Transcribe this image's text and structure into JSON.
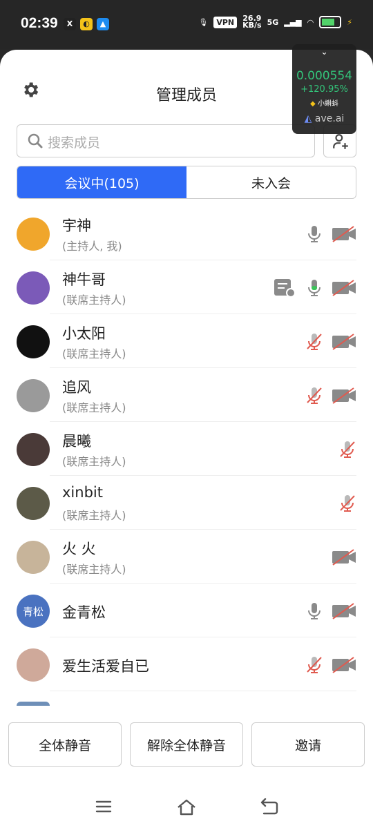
{
  "status_bar": {
    "time": "02:39",
    "vpn": "VPN",
    "speed": "26.9",
    "speed_unit": "KB/s",
    "network": "5G"
  },
  "overlay": {
    "price": "0.000554",
    "change": "+120.95%",
    "token": "小蝌蚪",
    "brand": "ave.ai"
  },
  "header": {
    "title": "管理成员"
  },
  "search": {
    "placeholder": "搜索成员"
  },
  "tabs": [
    {
      "label": "会议中(105)",
      "active": true
    },
    {
      "label": "未入会",
      "active": false
    }
  ],
  "members": [
    {
      "name": "宇神",
      "role": "(主持人, 我)",
      "avatar_text": "",
      "avatar_color": "#f0a62c",
      "share": false,
      "mic": "on",
      "cam": "off"
    },
    {
      "name": "神牛哥",
      "role": "(联席主持人)",
      "avatar_text": "",
      "avatar_color": "#7b5ab8",
      "share": true,
      "mic": "speaking",
      "cam": "off"
    },
    {
      "name": "小太阳",
      "role": "(联席主持人)",
      "avatar_text": "",
      "avatar_color": "#111111",
      "share": false,
      "mic": "off",
      "cam": "off"
    },
    {
      "name": "追风",
      "role": "(联席主持人)",
      "avatar_text": "",
      "avatar_color": "#9a9a9a",
      "share": false,
      "mic": "off",
      "cam": "off"
    },
    {
      "name": "晨曦",
      "role": "(联席主持人)",
      "avatar_text": "",
      "avatar_color": "#4a3a38",
      "share": false,
      "mic": "off",
      "cam": "none"
    },
    {
      "name": "xinbit",
      "role": "(联席主持人)",
      "avatar_text": "",
      "avatar_color": "#5c5a48",
      "share": false,
      "mic": "off",
      "cam": "none"
    },
    {
      "name": "火 火",
      "role": "(联席主持人)",
      "avatar_text": "",
      "avatar_color": "#c7b49a",
      "share": false,
      "mic": "none",
      "cam": "off"
    },
    {
      "name": "金青松",
      "role": "",
      "avatar_text": "青松",
      "avatar_color": "#4a72c0",
      "share": false,
      "mic": "on",
      "cam": "off"
    },
    {
      "name": "爱生活爱自已",
      "role": "",
      "avatar_text": "",
      "avatar_color": "#cfa99a",
      "share": false,
      "mic": "off",
      "cam": "off"
    }
  ],
  "actions": {
    "mute_all": "全体静音",
    "unmute_all": "解除全体静音",
    "invite": "邀请"
  },
  "colors": {
    "accent": "#2f6af6",
    "muted_red": "#e05a4f",
    "icon_gray": "#8a8a8a",
    "speaking_green": "#3cc35a"
  }
}
